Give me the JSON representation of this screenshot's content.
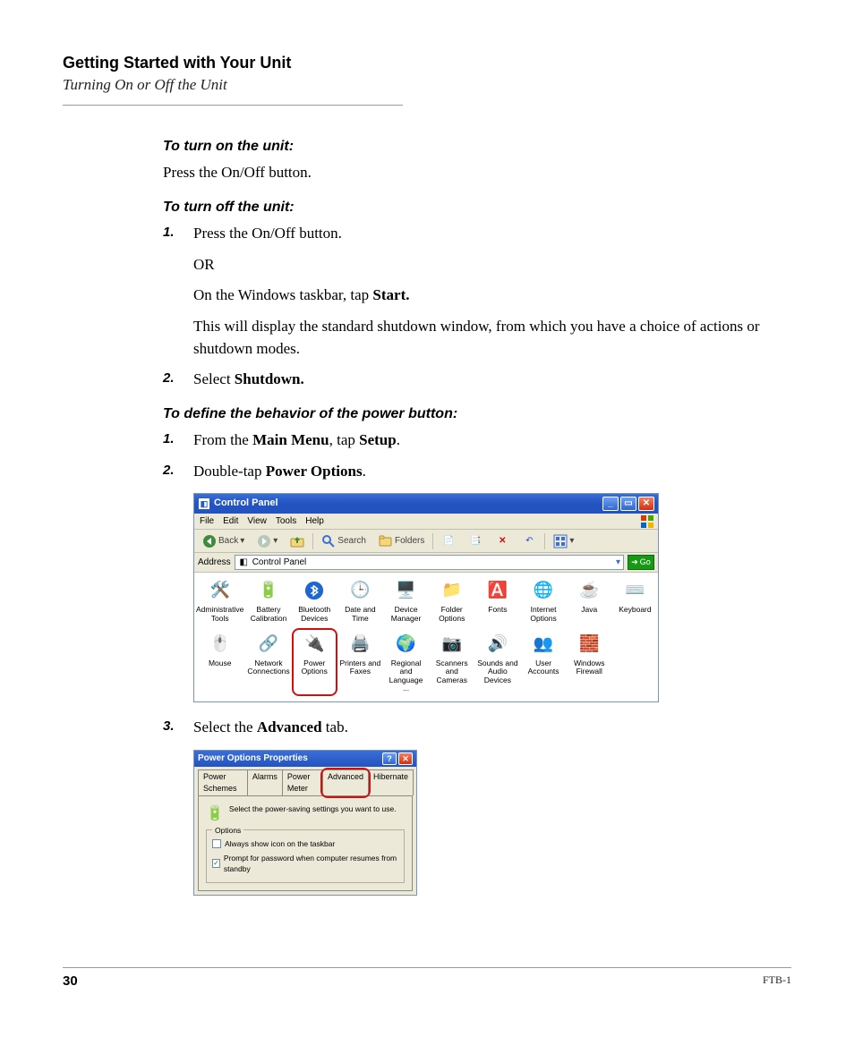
{
  "header": {
    "chapter": "Getting Started with Your Unit",
    "section": "Turning On or Off the Unit"
  },
  "procs": {
    "turn_on_head": "To turn on the unit:",
    "turn_on_body": "Press the On/Off button.",
    "turn_off_head": "To turn off the unit:",
    "turn_off_step1_lead": "Press the On/Off button.",
    "turn_off_step1_or": "OR",
    "turn_off_step1_line2a": "On the Windows taskbar, tap ",
    "turn_off_step1_line2b": "Start.",
    "turn_off_step1_line3": "This will display the standard shutdown window, from which you have a choice of actions or shutdown modes.",
    "turn_off_step2a": "Select ",
    "turn_off_step2b": "Shutdown.",
    "power_head": "To define the behavior of the power button:",
    "power_step1a": "From the ",
    "power_step1b": "Main Menu",
    "power_step1c": ", tap ",
    "power_step1d": "Setup",
    "power_step1e": ".",
    "power_step2a": "Double-tap ",
    "power_step2b": "Power Options",
    "power_step2c": ".",
    "power_step3a": "Select the ",
    "power_step3b": "Advanced",
    "power_step3c": " tab."
  },
  "nums": {
    "n1": "1.",
    "n2": "2.",
    "n3": "3."
  },
  "cp": {
    "title": "Control Panel",
    "menu": {
      "file": "File",
      "edit": "Edit",
      "view": "View",
      "tools": "Tools",
      "help": "Help"
    },
    "toolbar": {
      "back": "Back",
      "search": "Search",
      "folders": "Folders"
    },
    "address_label": "Address",
    "address_value": "Control Panel",
    "go": "Go",
    "items_row1": [
      "Administrative Tools",
      "Battery Calibration",
      "Bluetooth Devices",
      "Date and Time",
      "Device Manager",
      "Folder Options",
      "Fonts",
      "Internet Options",
      "Java"
    ],
    "items_row1_last": "Keyboard",
    "items_row2": [
      "Mouse",
      "Network Connections",
      "Power Options",
      "Printers and Faxes",
      "Regional and Language ...",
      "Scanners and Cameras",
      "Sounds and Audio Devices",
      "User Accounts",
      "Windows Firewall"
    ]
  },
  "po": {
    "title": "Power Options Properties",
    "tabs": [
      "Power Schemes",
      "Alarms",
      "Power Meter",
      "Advanced",
      "Hibernate"
    ],
    "note": "Select the power-saving settings you want to use.",
    "group": "Options",
    "chk1": "Always show icon on the taskbar",
    "chk2": "Prompt for password when computer resumes from standby"
  },
  "footer": {
    "page": "30",
    "doc": "FTB-1"
  }
}
